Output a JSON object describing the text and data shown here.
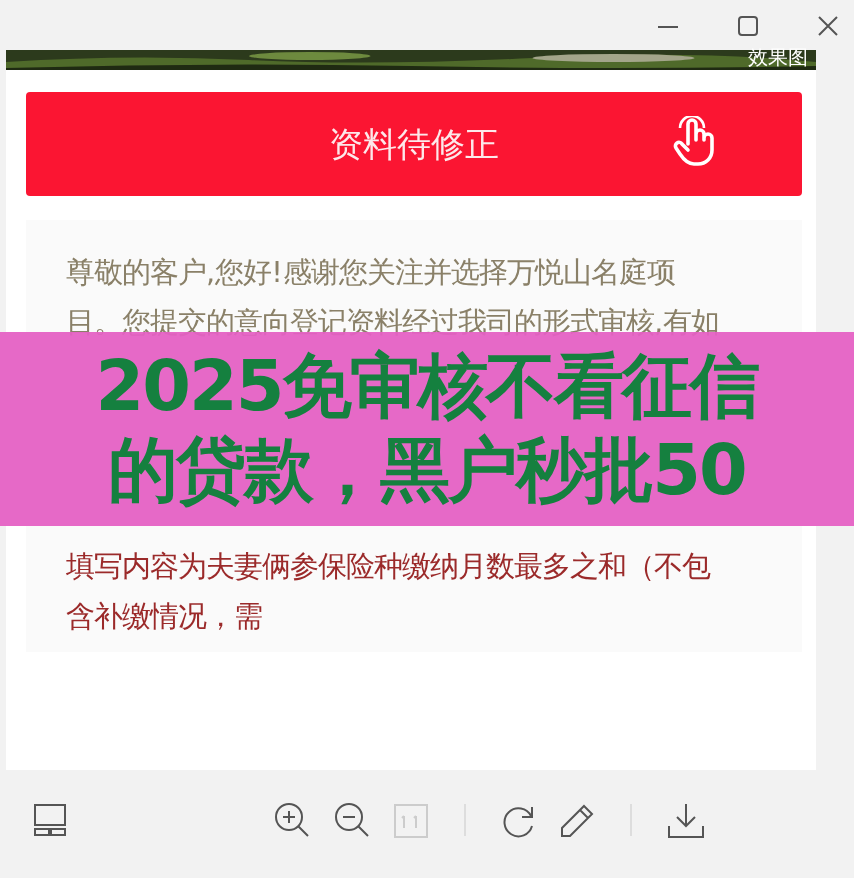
{
  "window": {
    "controls": [
      {
        "kind": "minimize"
      },
      {
        "kind": "maximize"
      },
      {
        "kind": "close"
      }
    ]
  },
  "image": {
    "watermark": "效果图",
    "action_button": {
      "label": "资料待修正"
    },
    "lines_top": [
      "尊敬的客户,您好!感谢您关注并选择万悦山名庭项",
      "目。您提交的意向登记资料经过我司的形式审核,有如"
    ],
    "lines_bottom": [
      "填写内容为夫妻俩参保险种缴纳月数最多之和（不包",
      "含补缴情况，需"
    ]
  },
  "banner": {
    "lines": [
      "2025免审核不看征信",
      "的贷款，黑户秒批50"
    ]
  },
  "toolbar": {
    "left": [
      {
        "kind": "thumbnails"
      }
    ],
    "groups": [
      [
        {
          "kind": "zoom-in"
        },
        {
          "kind": "zoom-out"
        },
        {
          "kind": "actual-size"
        }
      ],
      [
        {
          "kind": "rotate"
        },
        {
          "kind": "edit"
        }
      ],
      [
        {
          "kind": "download"
        }
      ]
    ]
  }
}
